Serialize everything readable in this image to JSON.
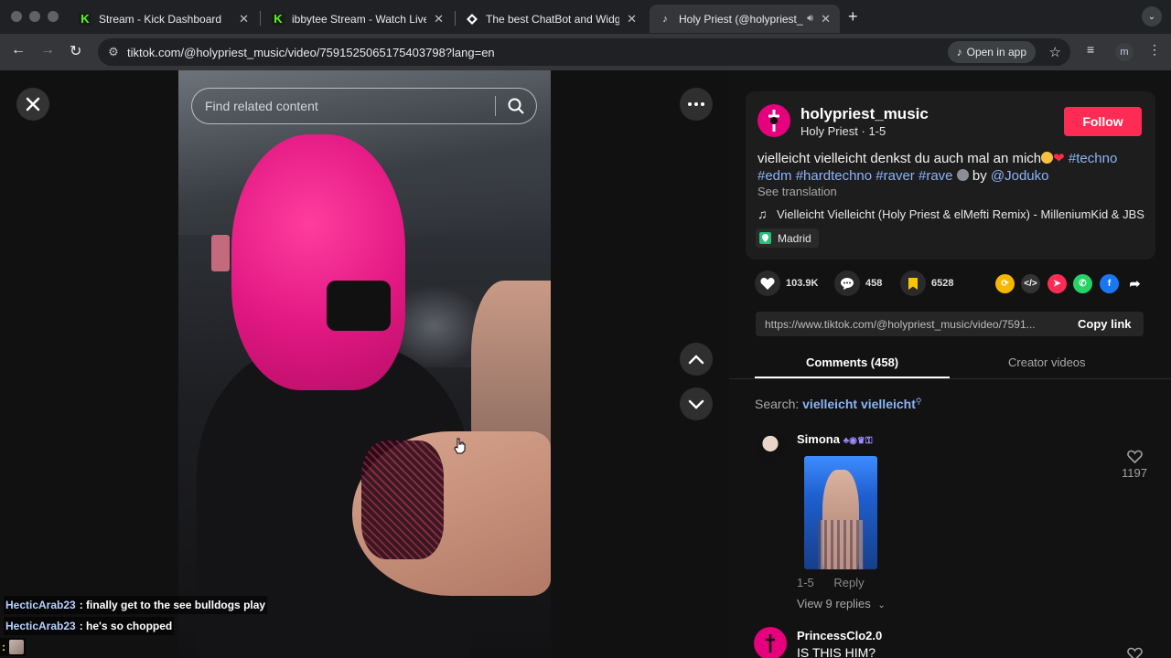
{
  "browser": {
    "tabs": [
      {
        "title": "Stream - Kick Dashboard",
        "favicon": "kick-icon"
      },
      {
        "title": "ibbytee Stream - Watch Live o",
        "favicon": "kick-icon"
      },
      {
        "title": "The best ChatBot and Widget",
        "favicon": "diamond-icon"
      },
      {
        "title": "Holy Priest (@holypriest_",
        "favicon": "tiktok-icon",
        "active": true
      }
    ],
    "url": "tiktok.com/@holypriest_music/video/7591525065175403798?lang=en",
    "open_in_app": "Open in app",
    "profile_initial": "m"
  },
  "video": {
    "search_placeholder": "Find related content"
  },
  "chat": [
    {
      "user": "HecticArab23",
      "message": ": finally get to the see bulldogs play"
    },
    {
      "user": "HecticArab23",
      "message": ": he's so chopped"
    },
    {
      "user": "",
      "message": ":"
    }
  ],
  "post": {
    "username": "holypriest_music",
    "display_name": "Holy Priest",
    "date": "1-5",
    "follow": "Follow",
    "caption_text": "vielleicht vielleicht denkst du auch mal an mich",
    "hashtags": [
      "#techno",
      "#edm",
      "#hardtechno",
      "#raver",
      "#rave"
    ],
    "by": "by",
    "mention": "@Joduko",
    "see_translation": "See translation",
    "music": "Vielleicht Vielleicht (Holy Priest & elMefti Remix) - MilleniumKid & JBS",
    "location": "Madrid"
  },
  "stats": {
    "likes": "103.9K",
    "comments": "458",
    "saves": "6528"
  },
  "share": {
    "link": "https://www.tiktok.com/@holypriest_music/video/7591...",
    "copy_link": "Copy link"
  },
  "tabs": {
    "comments": "Comments (458)",
    "creator_videos": "Creator videos"
  },
  "search": {
    "label": "Search:",
    "term": "vielleicht vielleicht"
  },
  "comments": [
    {
      "user": "Simona",
      "date": "1-5",
      "reply": "Reply",
      "likes": "1197",
      "view_replies": "View 9 replies"
    },
    {
      "user": "PrincessClo2.0",
      "text": "IS THIS HIM?"
    }
  ],
  "colors": {
    "accent": "#fe2c55",
    "brand_pink": "#e6007e",
    "link_blue": "#8ab4f8"
  }
}
